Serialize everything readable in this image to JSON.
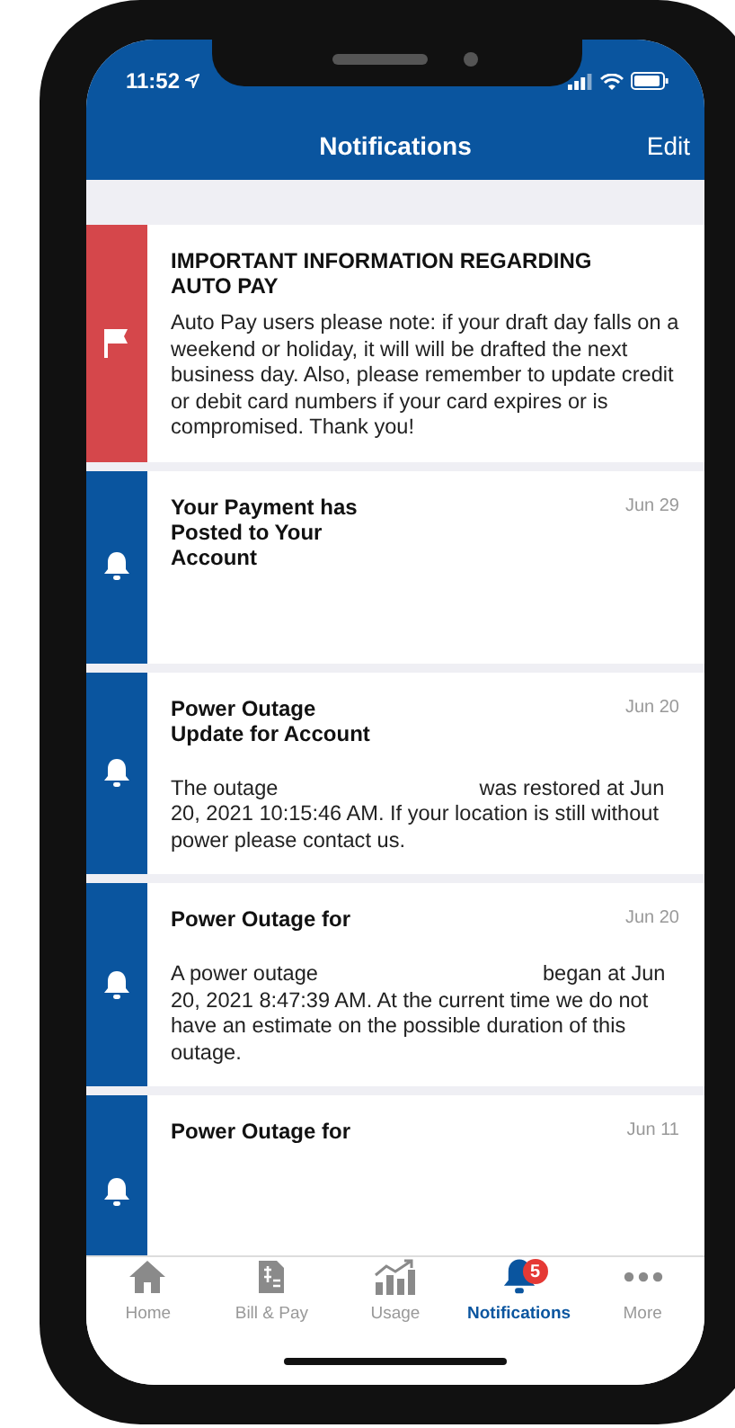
{
  "status_bar": {
    "time": "11:52"
  },
  "header": {
    "title": "Notifications",
    "action": "Edit"
  },
  "notifications": [
    {
      "kind": "alert",
      "color": "#d5474b",
      "title": "IMPORTANT INFORMATION REGARDING\nAUTO PAY",
      "body": [
        "Auto Pay users please note: if your draft day falls on a weekend or holiday, it will will be drafted the next business day. Also, please remember to update credit or debit card numbers if your card expires or is compromised. Thank you!"
      ]
    },
    {
      "kind": "notice",
      "color": "#0a559f",
      "title": "Your Payment has\nPosted to Your\nAccount",
      "date": "Jun 29"
    },
    {
      "kind": "notice",
      "color": "#0a559f",
      "title": "Power Outage\nUpdate for Account",
      "date": "Jun 20",
      "body": [
        "The outage",
        "was restored at Jun 20, 2021 10:15:46 AM. If your location is still without power please contact us."
      ]
    },
    {
      "kind": "notice",
      "color": "#0a559f",
      "title": "Power Outage for",
      "date": "Jun 20",
      "body": [
        "A power outage",
        "began at Jun 20, 2021 8:47:39 AM. At the current time we do not have an estimate on the possible duration of this outage."
      ]
    },
    {
      "kind": "notice",
      "color": "#0a559f",
      "title": "Power Outage for",
      "date": "Jun 11"
    }
  ],
  "tabs": [
    {
      "kind": "home",
      "label": "Home",
      "selected": false
    },
    {
      "kind": "bill",
      "label": "Bill & Pay",
      "selected": false
    },
    {
      "kind": "usage",
      "label": "Usage",
      "selected": false
    },
    {
      "kind": "bell",
      "label": "Notifications",
      "selected": true,
      "badge": "5"
    },
    {
      "kind": "more",
      "label": "More",
      "selected": false
    }
  ]
}
